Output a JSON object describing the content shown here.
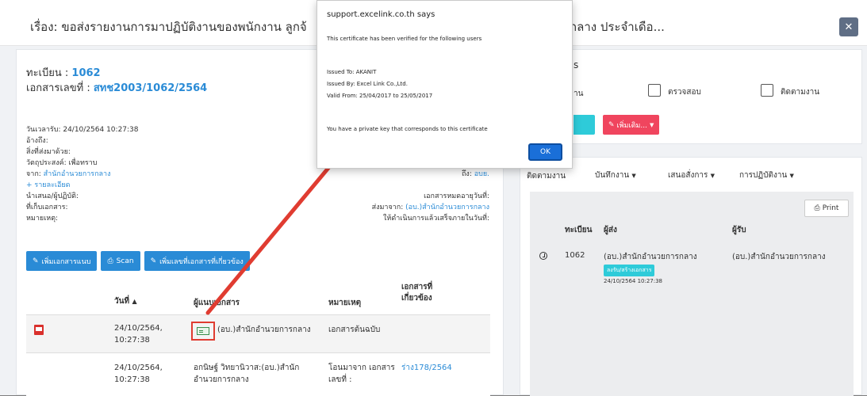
{
  "modal": {
    "title": "เรื่อง: ขอส่งรายงานการมาปฏิบัติงานของพนักงาน ลูกจ้",
    "title_tail": "รกลาง ประจำเดือ...",
    "close_icon": "close-icon"
  },
  "record": {
    "reg_label": "ทะเบียน : ",
    "reg_value": "1062",
    "doc_label": "เอกสารเลขที่ : ",
    "doc_value": "สทช2003/1062/2564",
    "received": "วันเวลารับ: 24/10/2564 10:27:38",
    "ref": "อ้างถึง:",
    "attachment": "สิ่งที่ส่งมาด้วย:",
    "purpose": "วัตถุประสงค์: เพื่อทราบ",
    "from_label": "จาก: ",
    "from_value": "สำนักอำนวยการกลาง",
    "to_label": "ถึง: ",
    "to_value": "อบย.",
    "details_link": "+ รายละเอียด",
    "presenter": "นำเสนอ/ผู้ปฏิบัติ:",
    "expire": "เอกสารหมดอายุวันที่:",
    "storage": "ที่เก็บเอกสาร:",
    "sent_to_label": "ส่งมาจาก: ",
    "sent_to_value": "(อบ.)สำนักอำนวยการกลาง",
    "note": "หมายเหตุ:",
    "deadline": "ให้ดำเนินการแล้วเสร็จภายในวันที่:"
  },
  "buttons": {
    "add_attachment": "เพิ่มเอกสารแนบ",
    "scan": "Scan",
    "add_related": "เพิ่มเลขที่เอกสารที่เกี่ยวข้อง"
  },
  "table": {
    "headers": {
      "date": "วันที่",
      "attacher": "ผู้แนบเอกสาร",
      "note": "หมายเหตุ",
      "related_1": "เอกสารที่",
      "related_2": "เกี่ยวข้อง"
    },
    "rows": [
      {
        "date_1": "24/10/2564,",
        "date_2": "10:27:38",
        "attacher": "(อบ.)สำนักอำนวยการกลาง",
        "note": "เอกสารต้นฉบับ",
        "related": ""
      },
      {
        "date_1": "24/10/2564,",
        "date_2": "10:27:38",
        "attacher_1": "อกนิษฐ์ วิทยานิวาส:(อบ.)สำนัก",
        "attacher_2": "อำนวยการกลาง",
        "note_1": "โอนมาจาก เอกสาร",
        "note_2": "เลขที่ :",
        "related": "ร่าง178/2564"
      }
    ]
  },
  "right_panel": {
    "section_partial": "s",
    "row_partial": "าน",
    "check_review": "ตรวจสอบ",
    "check_follow": "ติดตามงาน",
    "more_button": "เพิ่มเติม...",
    "tabs": {
      "partial": "ติดตามงาน",
      "log": "บันทึกงาน",
      "propose": "เสนอสั่งการ",
      "action": "การปฏิบัติงาน"
    },
    "print": "Print",
    "headers": {
      "reg": "ทะเบียน",
      "sender": "ผู้ส่ง",
      "receiver": "ผู้รับ"
    },
    "entry": {
      "reg": "1062",
      "sender": "(อบ.)สำนักอำนวยการกลาง",
      "receiver": "(อบ.)สำนักอำนวยการกลาง",
      "badge": "ลงรับ/สร้างเอกสาร",
      "time": "24/10/2564 10:27:38"
    }
  },
  "alert": {
    "title": "support.excelink.co.th says",
    "line1": "This certificate has been verified for the following users",
    "issued_to": "Issued To: AKANIT",
    "issued_by": "Issued By: Excel Link Co.,Ltd.",
    "valid": "Valid From: 25/04/2017  to  25/05/2017",
    "private_key": "You have a private key that corresponds to this certificate",
    "ok": "OK"
  },
  "colors": {
    "link": "#2a8bd6",
    "teal": "#2ecbd9",
    "pink": "#f0455e",
    "annotation_red": "#e03c31"
  }
}
